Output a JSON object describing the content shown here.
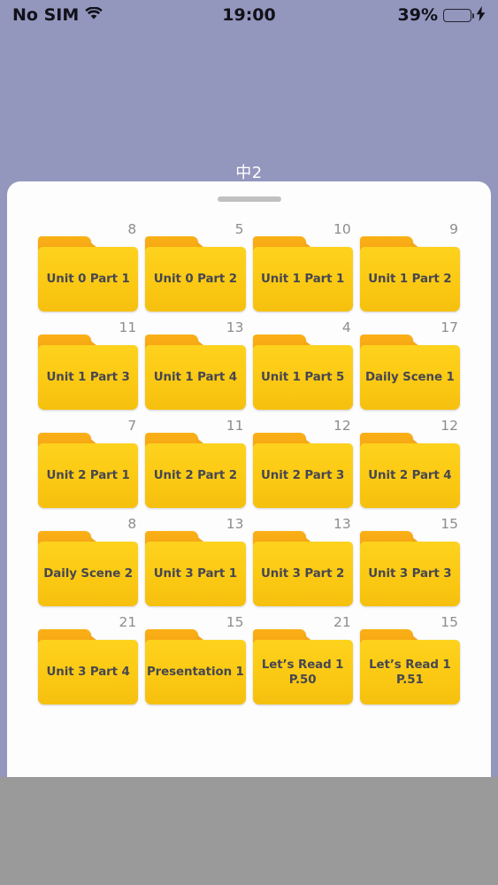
{
  "status_bar": {
    "carrier": "No SIM",
    "wifi_icon": "wifi-icon",
    "time": "19:00",
    "battery_percent": "39%",
    "battery_level": 39,
    "battery_color": "#4cd964",
    "charging_icon": "⚡"
  },
  "sheet": {
    "title": "中2",
    "grabber": "grabber-handle"
  },
  "folders": [
    {
      "label": "Unit 0 Part 1",
      "count": "8"
    },
    {
      "label": "Unit 0 Part 2",
      "count": "5"
    },
    {
      "label": "Unit 1 Part 1",
      "count": "10"
    },
    {
      "label": "Unit 1 Part 2",
      "count": "9"
    },
    {
      "label": "Unit 1 Part 3",
      "count": "11"
    },
    {
      "label": "Unit 1 Part 4",
      "count": "13"
    },
    {
      "label": "Unit 1 Part 5",
      "count": "4"
    },
    {
      "label": "Daily Scene 1",
      "count": "17"
    },
    {
      "label": "Unit 2 Part 1",
      "count": "7"
    },
    {
      "label": "Unit 2 Part 2",
      "count": "11"
    },
    {
      "label": "Unit 2 Part 3",
      "count": "12"
    },
    {
      "label": "Unit 2 Part 4",
      "count": "12"
    },
    {
      "label": "Daily Scene 2",
      "count": "8"
    },
    {
      "label": "Unit 3 Part 1",
      "count": "13"
    },
    {
      "label": "Unit 3 Part 2",
      "count": "13"
    },
    {
      "label": "Unit 3 Part 3",
      "count": "15"
    },
    {
      "label": "Unit 3 Part 4",
      "count": "21"
    },
    {
      "label": "Presentation 1",
      "count": "15"
    },
    {
      "label": "Let’s Read 1\nP.50",
      "count": "21"
    },
    {
      "label": "Let’s Read 1\nP.51",
      "count": "15"
    }
  ],
  "colors": {
    "backdrop": "#9396bd",
    "sheet": "#fdfdfd",
    "folder_body": "#fbc913",
    "folder_tab": "#f5a614",
    "folder_label": "#474750",
    "count_text": "#8d8d8d",
    "bottom_area": "#9a9a9a"
  }
}
